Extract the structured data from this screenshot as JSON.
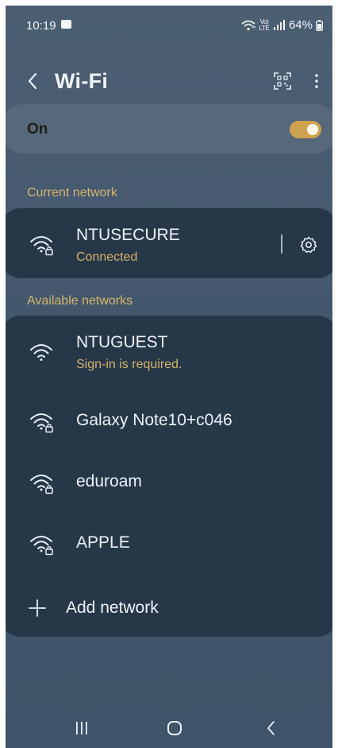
{
  "status_bar": {
    "time": "10:19",
    "volte": "Vo) LTE",
    "battery": "64%"
  },
  "header": {
    "title": "Wi-Fi",
    "icons": [
      "back-icon",
      "qr-scan-icon",
      "more-options-icon"
    ]
  },
  "wifi_toggle": {
    "label": "On",
    "state": "on",
    "accent_color": "#cfa24f"
  },
  "current_network": {
    "section_label": "Current network",
    "name": "NTUSECURE",
    "status": "Connected",
    "icon": "wifi-secured-icon"
  },
  "available_networks": {
    "section_label": "Available networks",
    "items": [
      {
        "name": "NTUGUEST",
        "status": "Sign-in is required.",
        "icon": "wifi-icon"
      },
      {
        "name": "Galaxy Note10+c046",
        "status": "",
        "icon": "wifi-secured-icon"
      },
      {
        "name": "eduroam",
        "status": "",
        "icon": "wifi-secured-icon"
      },
      {
        "name": "APPLE",
        "status": "",
        "icon": "wifi-secured-icon"
      }
    ],
    "add_label": "Add network"
  },
  "colors": {
    "background": "#465a6f",
    "card": "#263748",
    "accent_text": "#d4b16c"
  }
}
